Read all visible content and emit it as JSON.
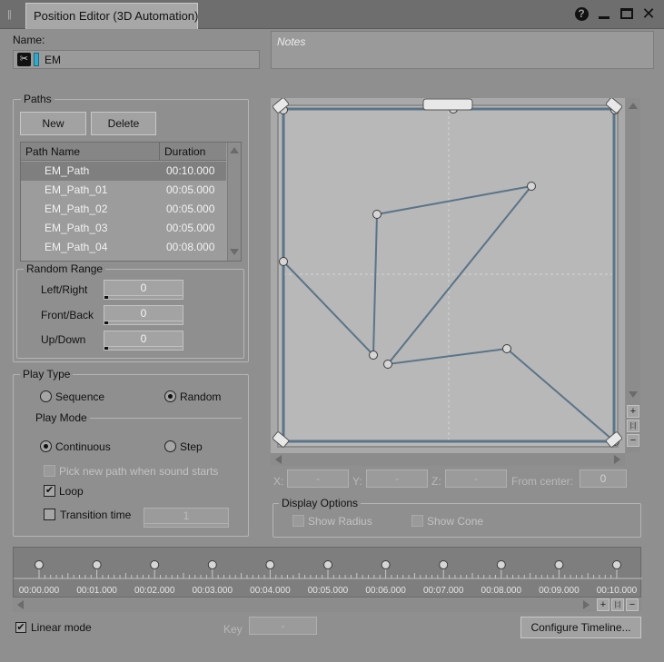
{
  "window": {
    "tab_title": "Position Editor (3D Automation)",
    "grip_glyph": "||",
    "help_glyph": "?",
    "close_glyph": "✕"
  },
  "name": {
    "label": "Name:",
    "value": "EM",
    "icon_glyph": "✂",
    "color": "#33a8c8"
  },
  "notes": {
    "placeholder": "Notes"
  },
  "paths": {
    "title": "Paths",
    "new_label": "New",
    "delete_label": "Delete",
    "columns": [
      "Path Name",
      "Duration"
    ],
    "rows": [
      {
        "name": "EM_Path",
        "duration": "00:10.000",
        "selected": true
      },
      {
        "name": "EM_Path_01",
        "duration": "00:05.000",
        "selected": false
      },
      {
        "name": "EM_Path_02",
        "duration": "00:05.000",
        "selected": false
      },
      {
        "name": "EM_Path_03",
        "duration": "00:05.000",
        "selected": false
      },
      {
        "name": "EM_Path_04",
        "duration": "00:08.000",
        "selected": false
      }
    ]
  },
  "random_range": {
    "title": "Random Range",
    "left_right_label": "Left/Right",
    "left_right_value": "0",
    "front_back_label": "Front/Back",
    "front_back_value": "0",
    "up_down_label": "Up/Down",
    "up_down_value": "0"
  },
  "play_type": {
    "title": "Play Type",
    "sequence_label": "Sequence",
    "random_label": "Random",
    "selected": "Random"
  },
  "play_mode": {
    "title": "Play Mode",
    "continuous_label": "Continuous",
    "step_label": "Step",
    "selected": "Continuous",
    "pick_new_label": "Pick new path when sound starts",
    "pick_new_checked": false,
    "loop_label": "Loop",
    "loop_checked": true,
    "transition_label": "Transition time",
    "transition_checked": false,
    "transition_value": "1"
  },
  "editor": {
    "zoom_in_glyph": "+",
    "zoom_fit_glyph": "|:|",
    "zoom_out_glyph": "−",
    "path_color": "#5a7488",
    "points": [
      [
        0.02,
        0.445
      ],
      [
        0.305,
        0.73
      ],
      [
        0.33,
        0.745
      ],
      [
        0.66,
        0.71
      ],
      [
        0.985,
        0.985
      ],
      [
        0.985,
        0.02
      ],
      [
        0.02,
        0.02
      ],
      [
        0.02,
        0.985
      ],
      [
        0.985,
        0.985
      ]
    ]
  },
  "coords": {
    "x_label": "X:",
    "x_value": "-",
    "y_label": "Y:",
    "y_value": "-",
    "z_label": "Z:",
    "z_value": "-",
    "from_center_label": "From center:",
    "from_center_value": "0"
  },
  "display_options": {
    "title": "Display Options",
    "show_radius_label": "Show Radius",
    "show_cone_label": "Show Cone"
  },
  "timeline": {
    "ticks": [
      "00:00.000",
      "00:01.000",
      "00:02.000",
      "00:03.000",
      "00:04.000",
      "00:05.000",
      "00:06.000",
      "00:07.000",
      "00:08.000",
      "00:09.000",
      "00:10.000"
    ],
    "linear_mode_label": "Linear mode",
    "linear_mode_checked": true,
    "key_label": "Key",
    "key_value": "-",
    "configure_label": "Configure Timeline..."
  }
}
